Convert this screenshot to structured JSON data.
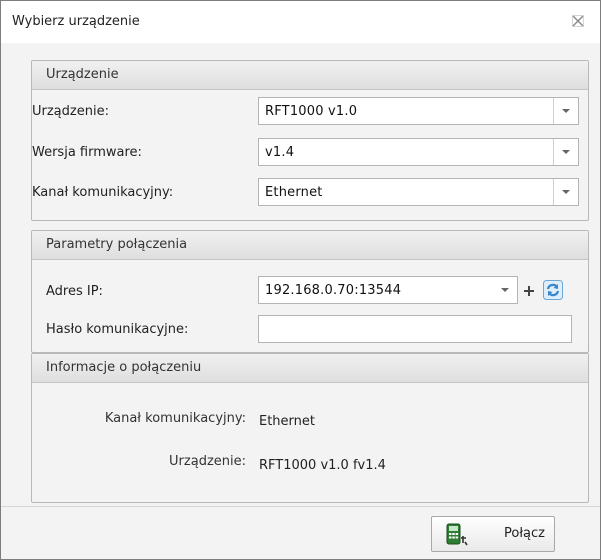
{
  "window": {
    "title": "Wybierz urządzenie"
  },
  "device_group": {
    "header": "Urządzenie",
    "device_label": "Urządzenie:",
    "device_value": "RFT1000 v1.0",
    "firmware_label": "Wersja firmware:",
    "firmware_value": "v1.4",
    "channel_label": "Kanał komunikacyjny:",
    "channel_value": "Ethernet"
  },
  "connection_group": {
    "header": "Parametry połączenia",
    "ip_label": "Adres IP:",
    "ip_value": "192.168.0.70:13544",
    "password_label": "Hasło komunikacyjne:",
    "password_value": ""
  },
  "info_group": {
    "header": "Informacje o połączeniu",
    "channel_label": "Kanał komunikacyjny:",
    "channel_value": "Ethernet",
    "device_label": "Urządzenie:",
    "device_value": "RFT1000 v1.0 fv1.4"
  },
  "footer": {
    "connect_label": "Połącz"
  },
  "icons": {
    "close": "close-icon",
    "dropdown": "chevron-down-icon",
    "add": "plus-icon",
    "refresh": "refresh-icon",
    "connect": "device-connect-icon"
  },
  "colors": {
    "refresh_accent": "#3b86c8",
    "connect_icon": "#2e7d32"
  }
}
